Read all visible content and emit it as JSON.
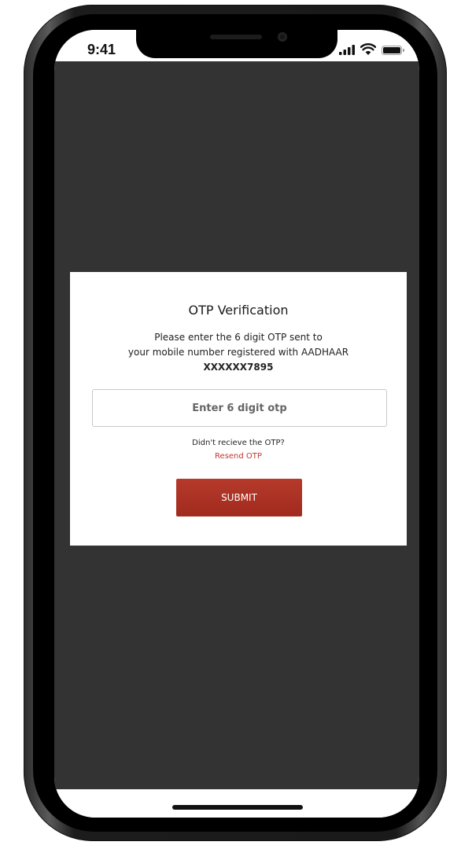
{
  "status_bar": {
    "time": "9:41",
    "icons": [
      "signal-icon",
      "wifi-icon",
      "battery-icon"
    ]
  },
  "otp_dialog": {
    "title": "OTP Verification",
    "message_line1": "Please enter the 6 digit OTP sent to",
    "message_line2": "your mobile number registered with AADHAAR",
    "masked_number": "XXXXXX7895",
    "input_placeholder": "Enter 6 digit otp",
    "input_value": "",
    "resend_prompt": "Didn't recieve the OTP?",
    "resend_link": "Resend OTP",
    "submit_label": "SUBMIT"
  },
  "colors": {
    "app_background": "#333333",
    "accent": "#b23526",
    "resend_link": "#c0362c"
  }
}
